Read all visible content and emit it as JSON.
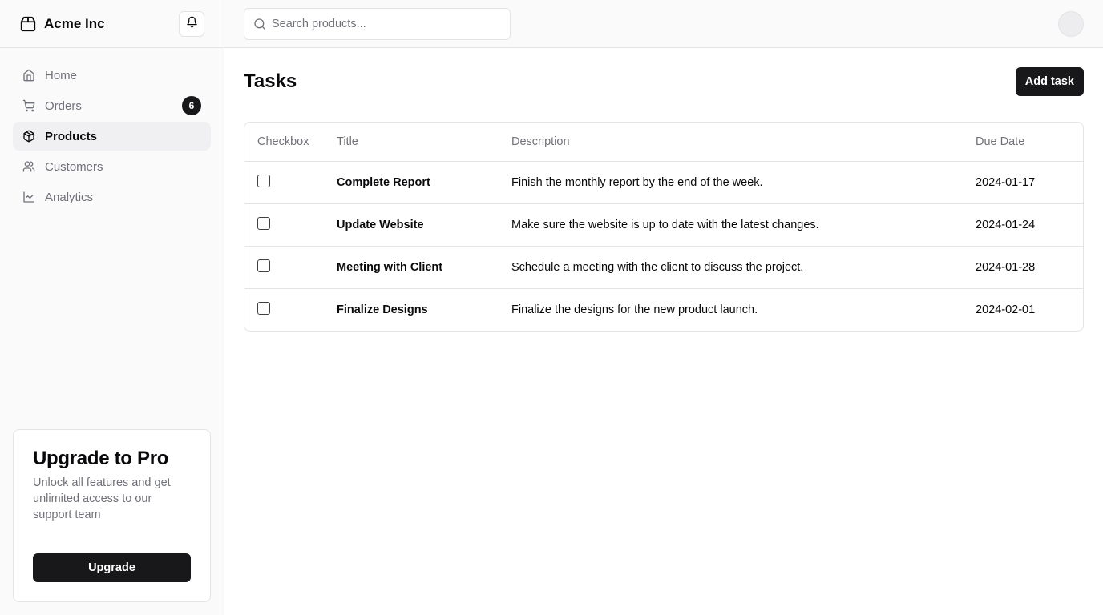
{
  "brand": {
    "name": "Acme Inc"
  },
  "sidebar": {
    "items": [
      {
        "label": "Home",
        "icon": "home-icon"
      },
      {
        "label": "Orders",
        "icon": "cart-icon",
        "badge": "6"
      },
      {
        "label": "Products",
        "icon": "package-icon",
        "active": true
      },
      {
        "label": "Customers",
        "icon": "users-icon"
      },
      {
        "label": "Analytics",
        "icon": "line-chart-icon"
      }
    ]
  },
  "upgrade": {
    "title": "Upgrade to Pro",
    "description": "Unlock all features and get unlimited access to our support team",
    "button_label": "Upgrade"
  },
  "header": {
    "search_placeholder": "Search products..."
  },
  "main": {
    "title": "Tasks",
    "add_button_label": "Add task",
    "table": {
      "columns": [
        "Checkbox",
        "Title",
        "Description",
        "Due Date"
      ],
      "rows": [
        {
          "title": "Complete Report",
          "description": "Finish the monthly report by the end of the week.",
          "due_date": "2024-01-17",
          "checked": false
        },
        {
          "title": "Update Website",
          "description": "Make sure the website is up to date with the latest changes.",
          "due_date": "2024-01-24",
          "checked": false
        },
        {
          "title": "Meeting with Client",
          "description": "Schedule a meeting with the client to discuss the project.",
          "due_date": "2024-01-28",
          "checked": false
        },
        {
          "title": "Finalize Designs",
          "description": "Finalize the designs for the new product launch.",
          "due_date": "2024-02-01",
          "checked": false
        }
      ]
    }
  },
  "colors": {
    "accent": "#18181b",
    "muted_text": "#71717a",
    "border": "#e4e4e7",
    "sidebar_bg": "#fafafa"
  }
}
